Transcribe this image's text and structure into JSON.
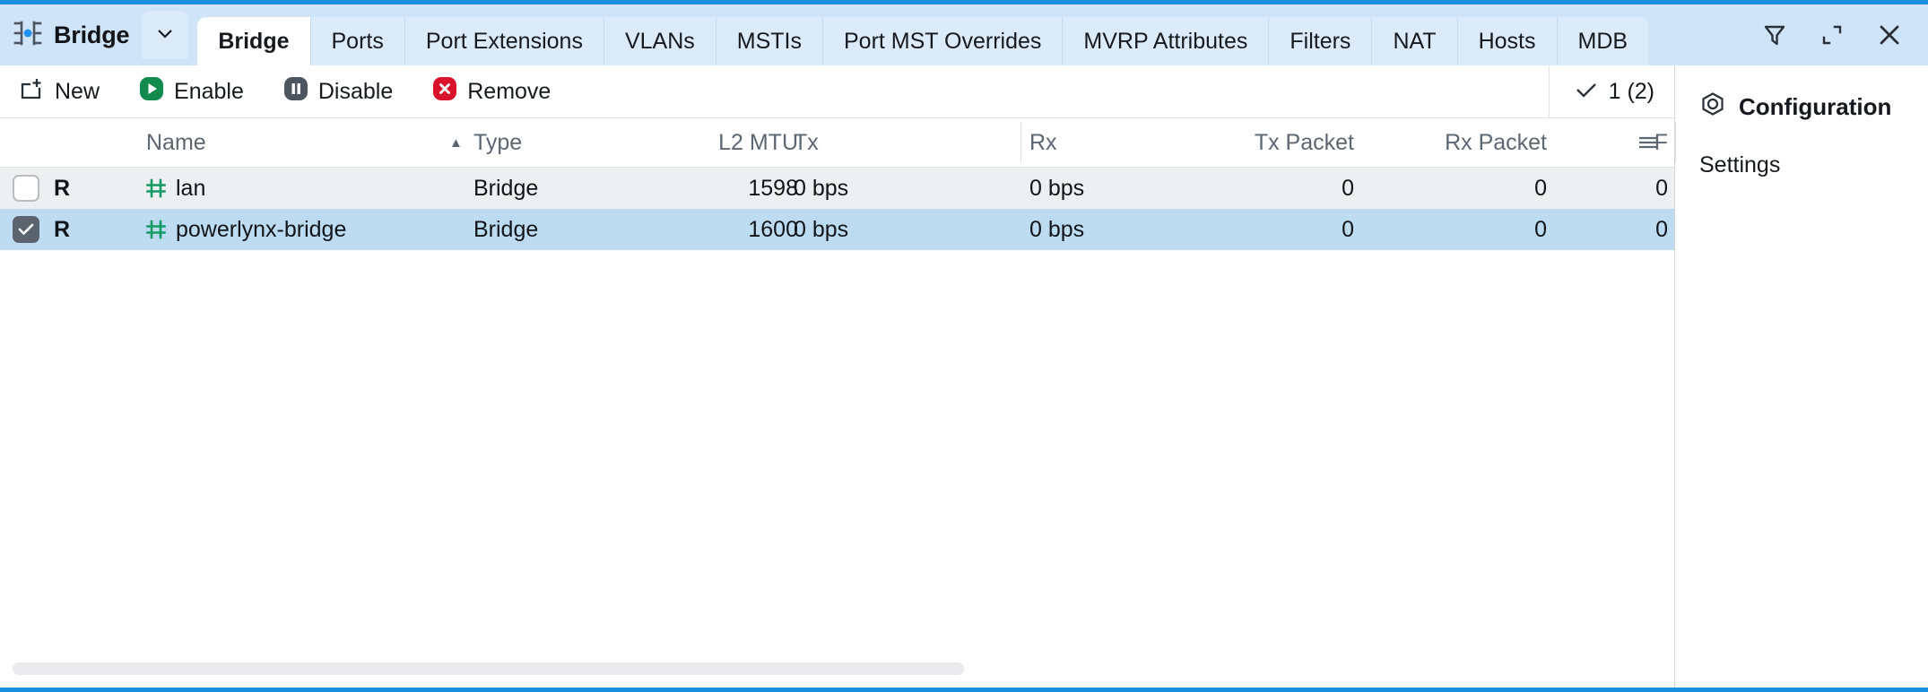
{
  "window": {
    "brand_title": "Bridge",
    "brand_icon": "bridge-icon",
    "caret_icon": "chevron-down-icon"
  },
  "tabs": [
    {
      "label": "Bridge",
      "active": true
    },
    {
      "label": "Ports",
      "active": false
    },
    {
      "label": "Port Extensions",
      "active": false
    },
    {
      "label": "VLANs",
      "active": false
    },
    {
      "label": "MSTIs",
      "active": false
    },
    {
      "label": "Port MST Overrides",
      "active": false
    },
    {
      "label": "MVRP Attributes",
      "active": false
    },
    {
      "label": "Filters",
      "active": false
    },
    {
      "label": "NAT",
      "active": false
    },
    {
      "label": "Hosts",
      "active": false
    },
    {
      "label": "MDB",
      "active": false
    }
  ],
  "window_actions": [
    {
      "name": "filter-icon",
      "title": "Filter"
    },
    {
      "name": "restore-icon",
      "title": "Restore"
    },
    {
      "name": "close-icon",
      "title": "Close"
    }
  ],
  "toolbar": {
    "new_label": "New",
    "enable_label": "Enable",
    "disable_label": "Disable",
    "remove_label": "Remove",
    "selection_count": "1 (2)",
    "check_icon": "check-icon"
  },
  "table": {
    "columns": [
      {
        "key": "name",
        "label": "Name"
      },
      {
        "key": "type",
        "label": "Type"
      },
      {
        "key": "l2mtu",
        "label": "L2 MTU"
      },
      {
        "key": "tx",
        "label": "Tx"
      },
      {
        "key": "rx",
        "label": "Rx"
      },
      {
        "key": "txpacket",
        "label": "Tx Packet"
      },
      {
        "key": "rxpacket",
        "label": "Rx Packet"
      },
      {
        "key": "f",
        "label": "F"
      }
    ],
    "sort_column": "Type",
    "sort_direction": "asc",
    "rows": [
      {
        "checked": false,
        "flag": "R",
        "icon": "bridge-row-icon",
        "name": "lan",
        "type": "Bridge",
        "l2mtu": "1598",
        "tx": "0 bps",
        "rx": "0 bps",
        "txpacket": "0",
        "rxpacket": "0",
        "f": "0"
      },
      {
        "checked": true,
        "flag": "R",
        "icon": "bridge-row-icon",
        "name": "powerlynx-bridge",
        "type": "Bridge",
        "l2mtu": "1600",
        "tx": "0 bps",
        "rx": "0 bps",
        "txpacket": "0",
        "rxpacket": "0",
        "f": "0"
      }
    ]
  },
  "right_panel": {
    "title": "Configuration",
    "title_icon": "hex-nut-icon",
    "items": [
      {
        "label": "Settings"
      }
    ]
  },
  "colors": {
    "accent_blue": "#1a8fe0",
    "tabbar_bg": "#cfe4f7",
    "tab_bg": "#dcebfa",
    "selected_row": "#bddcf2",
    "odd_row": "#eeeff0",
    "enable_green": "#128a4e",
    "disable_gray": "#4d5560",
    "remove_red": "#d9112a",
    "bridge_glyph_green": "#149a63"
  }
}
